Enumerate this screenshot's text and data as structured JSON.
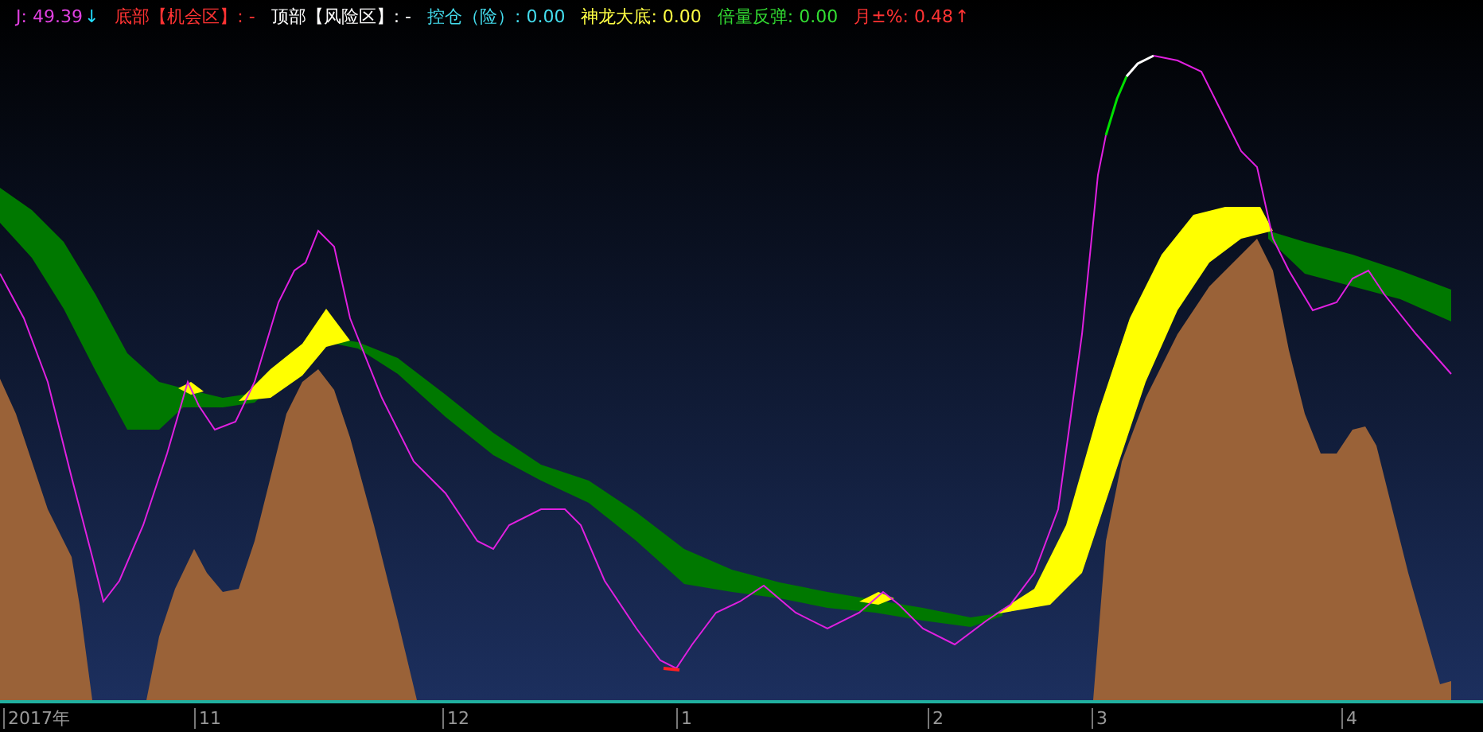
{
  "legend": [
    {
      "text": "J: 49.39",
      "color": "#e040e0",
      "arrow": {
        "text": "↓",
        "color": "#22ddff"
      }
    },
    {
      "text": "底部【机会区】: -",
      "color": "#ff3333"
    },
    {
      "text": "顶部【风险区】: -",
      "color": "#ffffff"
    },
    {
      "text": "控仓（险）: 0.00",
      "color": "#44ddee"
    },
    {
      "text": "神龙大底: 0.00",
      "color": "#ffff44"
    },
    {
      "text": "倍量反弹: 0.00",
      "color": "#33dd33"
    },
    {
      "text": "月±%: 0.48",
      "color": "#ff3333",
      "arrow": {
        "text": "↑",
        "color": "#ff3333"
      }
    }
  ],
  "x_axis": {
    "labels": [
      "2017年",
      "11",
      "12",
      "1",
      "2",
      "3",
      "4"
    ]
  }
}
